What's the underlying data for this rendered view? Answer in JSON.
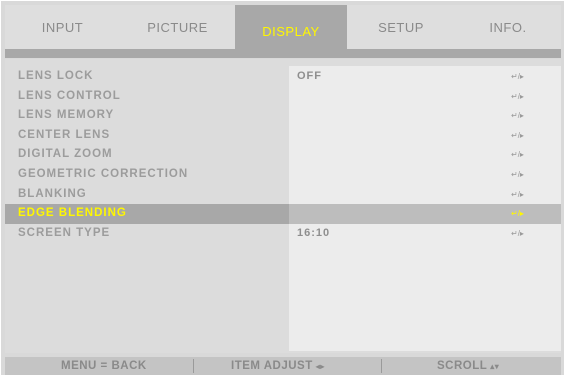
{
  "tabs": {
    "input": "INPUT",
    "picture": "PICTURE",
    "display": "DISPLAY",
    "setup": "SETUP",
    "info": "INFO."
  },
  "menu": {
    "items": [
      {
        "label": "LENS LOCK",
        "value": "OFF"
      },
      {
        "label": "LENS CONTROL",
        "value": ""
      },
      {
        "label": "LENS MEMORY",
        "value": ""
      },
      {
        "label": "CENTER LENS",
        "value": ""
      },
      {
        "label": "DIGITAL ZOOM",
        "value": ""
      },
      {
        "label": "GEOMETRIC CORRECTION",
        "value": ""
      },
      {
        "label": "BLANKING",
        "value": ""
      },
      {
        "label": "EDGE BLENDING",
        "value": ""
      },
      {
        "label": "SCREEN TYPE",
        "value": "16:10"
      }
    ],
    "selected_index": 7,
    "enter_icon": "↵/▸"
  },
  "bottom_bar": {
    "back": "MENU = BACK",
    "adjust": "ITEM ADJUST",
    "adjust_icon": "◂▸",
    "scroll": "SCROLL",
    "scroll_icon": "▴▾"
  },
  "colors": {
    "highlight_text": "#fff700",
    "active_tab_bg": "#a8a8a8"
  }
}
